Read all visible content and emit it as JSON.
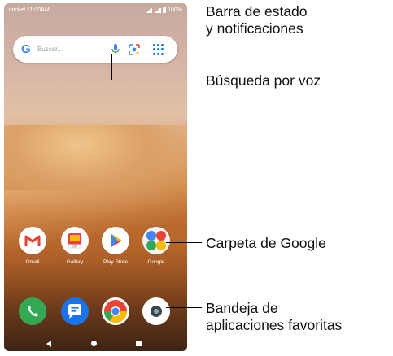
{
  "status_bar": {
    "carrier_time": "cricket 11:00AM",
    "battery": "100%"
  },
  "search": {
    "placeholder": "Buscar..."
  },
  "apps": [
    {
      "label": "Gmail"
    },
    {
      "label": "Gallery"
    },
    {
      "label": "Play Store"
    },
    {
      "label": "Google"
    }
  ],
  "dock": [
    "phone-icon",
    "messages-icon",
    "chrome-icon",
    "camera-icon"
  ],
  "callouts": {
    "status": [
      "Barra de estado",
      "y notificaciones"
    ],
    "voice": "Búsqueda por voz",
    "google_folder": "Carpeta de Google",
    "tray": [
      "Bandeja de",
      "aplicaciones favoritas"
    ]
  },
  "colors": {
    "google_blue": "#4285f4",
    "gmail_red": "#ea4335",
    "phone_green": "#34a853",
    "messages_blue": "#1a73e8"
  }
}
